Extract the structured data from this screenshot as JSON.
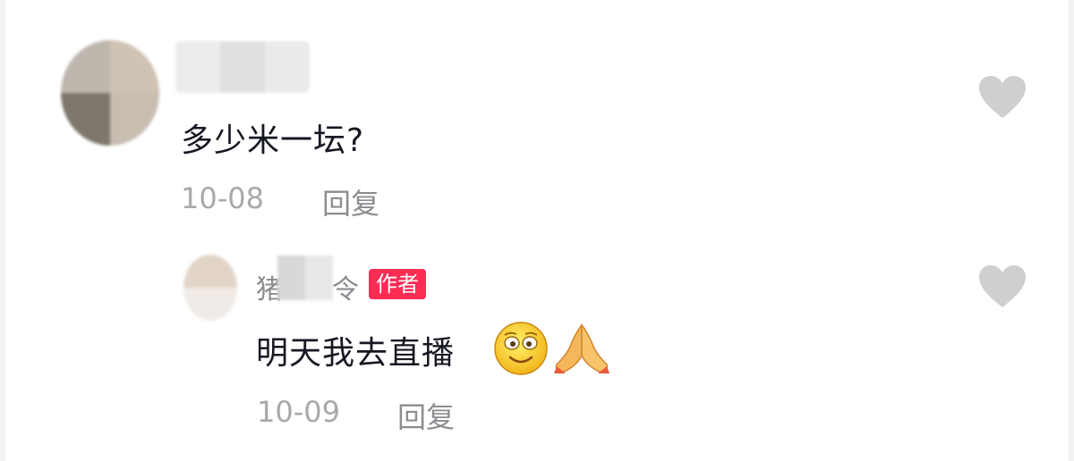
{
  "comment": {
    "text": "多少米一坛?",
    "date": "10-08",
    "reply_label": "回复"
  },
  "reply": {
    "username_prefix": "猪",
    "username_suffix": "令",
    "author_badge": "作者",
    "text": "明天我去直播",
    "emojis": [
      "smiling-face-emoji",
      "folded-hands-emoji"
    ],
    "date": "10-09",
    "reply_label": "回复"
  },
  "icons": {
    "like": "heart-icon"
  },
  "colors": {
    "author_badge": "#fe2c55",
    "heart": "#cfcfcf",
    "meta_text": "#a8a8ad",
    "body_text": "#161823"
  }
}
